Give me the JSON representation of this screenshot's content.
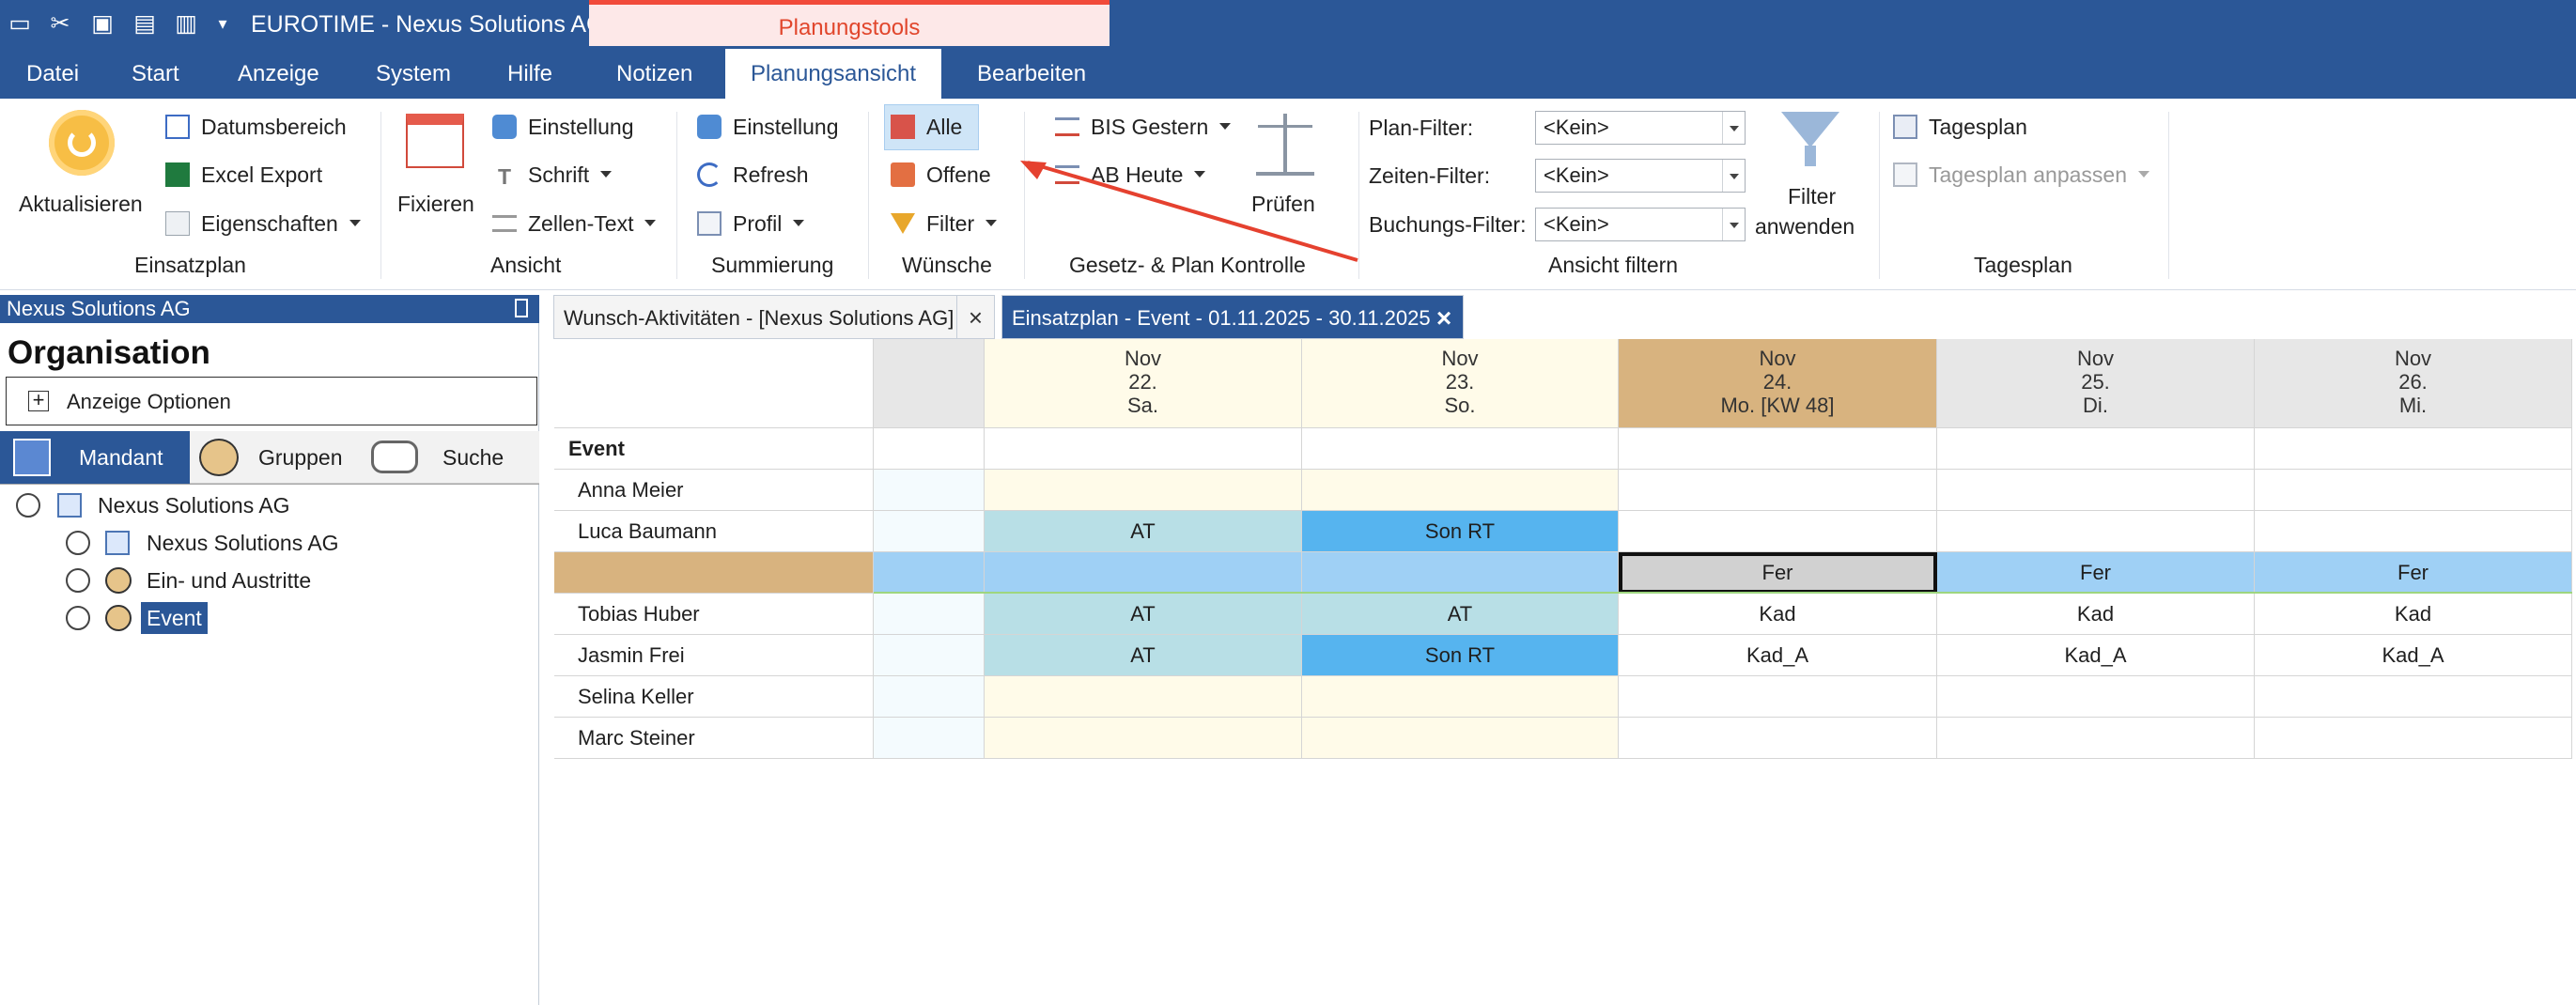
{
  "window": {
    "title": "EUROTIME - Nexus Solutions AG",
    "context_tab": "Planungstools"
  },
  "menu": [
    "Datei",
    "Start",
    "Anzeige",
    "System",
    "Hilfe",
    "Notizen",
    "Planungsansicht",
    "Bearbeiten"
  ],
  "ribbon": {
    "einsatzplan": {
      "label": "Einsatzplan",
      "aktualisieren": "Aktualisieren",
      "datumsbereich": "Datumsbereich",
      "excel_export": "Excel Export",
      "eigenschaften": "Eigenschaften"
    },
    "ansicht": {
      "label": "Ansicht",
      "fixieren": "Fixieren",
      "einstellung": "Einstellung",
      "schrift": "Schrift",
      "zellen_text": "Zellen-Text"
    },
    "summierung": {
      "label": "Summierung",
      "einstellung": "Einstellung",
      "refresh": "Refresh",
      "profil": "Profil"
    },
    "wuensche": {
      "label": "Wünsche",
      "alle": "Alle",
      "offene": "Offene",
      "filter": "Filter"
    },
    "gesetz": {
      "label": "Gesetz- & Plan Kontrolle",
      "bis_gestern": "BIS Gestern",
      "ab_heute": "AB Heute",
      "pruefen": "Prüfen"
    },
    "ansicht_filtern": {
      "label": "Ansicht filtern",
      "plan_filter_label": "Plan-Filter:",
      "plan_filter_value": "<Kein>",
      "zeiten_filter_label": "Zeiten-Filter:",
      "zeiten_filter_value": "<Kein>",
      "buchungs_filter_label": "Buchungs-Filter:",
      "buchungs_filter_value": "<Kein>",
      "filter_anwenden_line1": "Filter",
      "filter_anwenden_line2": "anwenden"
    },
    "tagesplan": {
      "label": "Tagesplan",
      "tagesplan": "Tagesplan",
      "tagesplan_anpassen": "Tagesplan anpassen"
    }
  },
  "left_panel": {
    "title": "Nexus Solutions AG",
    "heading": "Organisation",
    "options_label": "Anzeige Optionen",
    "tabs": [
      "Mandant",
      "Gruppen",
      "Suche"
    ],
    "tree": [
      {
        "label": "Nexus Solutions AG"
      },
      {
        "label": "Nexus Solutions AG"
      },
      {
        "label": "Ein- und Austritte"
      },
      {
        "label": "Event"
      }
    ]
  },
  "doc_tabs": [
    {
      "label": "Wunsch-Aktivitäten - [Nexus Solutions AG]"
    },
    {
      "label": "Einsatzplan - Event - 01.11.2025 - 30.11.2025"
    }
  ],
  "grid": {
    "group_label": "Event",
    "days": [
      {
        "month": "Nov",
        "day": "22.",
        "weekday": "Sa."
      },
      {
        "month": "Nov",
        "day": "23.",
        "weekday": "So."
      },
      {
        "month": "Nov",
        "day": "24.",
        "weekday": "Mo. [KW 48]"
      },
      {
        "month": "Nov",
        "day": "25.",
        "weekday": "Di."
      },
      {
        "month": "Nov",
        "day": "26.",
        "weekday": "Mi."
      }
    ],
    "rows": [
      {
        "name": "Anna Meier",
        "cells": [
          "",
          "",
          "",
          "",
          ""
        ]
      },
      {
        "name": "Luca Baumann",
        "cells": [
          "AT",
          "Son RT",
          "",
          "",
          ""
        ]
      },
      {
        "name": "",
        "cells": [
          "",
          "",
          "Fer",
          "Fer",
          "Fer"
        ]
      },
      {
        "name": "Tobias Huber",
        "cells": [
          "AT",
          "AT",
          "Kad",
          "Kad",
          "Kad"
        ]
      },
      {
        "name": "Jasmin Frei",
        "cells": [
          "AT",
          "Son RT",
          "Kad_A",
          "Kad_A",
          "Kad_A"
        ]
      },
      {
        "name": "Selina Keller",
        "cells": [
          "",
          "",
          "",
          "",
          ""
        ]
      },
      {
        "name": "Marc Steiner",
        "cells": [
          "",
          "",
          "",
          "",
          ""
        ]
      }
    ]
  }
}
